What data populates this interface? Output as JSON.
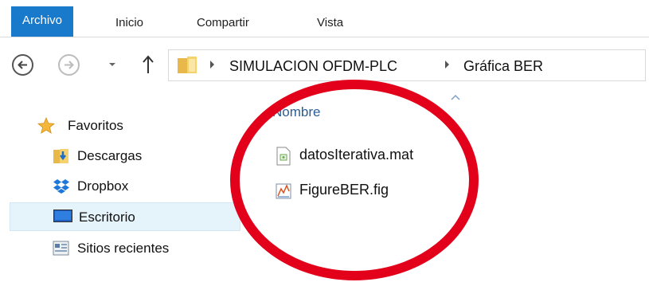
{
  "ribbon": {
    "tabs": [
      {
        "label": "Archivo",
        "active": true
      },
      {
        "label": "Inicio",
        "active": false
      },
      {
        "label": "Compartir",
        "active": false
      },
      {
        "label": "Vista",
        "active": false
      }
    ]
  },
  "nav": {
    "back_icon": "back-arrow-icon",
    "forward_icon": "forward-arrow-icon",
    "recent_icon": "chevron-down-icon",
    "up_icon": "up-arrow-icon"
  },
  "address": {
    "folder_icon": "folder-icon",
    "crumbs": [
      "SIMULACION OFDM-PLC",
      "Gráfica BER"
    ]
  },
  "sidebar": {
    "items": [
      {
        "label": "Favoritos",
        "icon": "star-icon"
      },
      {
        "label": "Descargas",
        "icon": "downloads-folder-icon"
      },
      {
        "label": "Dropbox",
        "icon": "dropbox-icon"
      },
      {
        "label": "Escritorio",
        "icon": "desktop-icon",
        "selected": true
      },
      {
        "label": "Sitios recientes",
        "icon": "recent-places-icon"
      }
    ]
  },
  "files": {
    "column_header": "Nombre",
    "items": [
      {
        "name": "datosIterativa.mat",
        "icon": "mat-file-icon"
      },
      {
        "name": "FigureBER.fig",
        "icon": "fig-file-icon"
      }
    ]
  },
  "colors": {
    "accent": "#1979ca",
    "annotation": "#e3001b",
    "header_text": "#2b5e95",
    "selection": "#e5f3fb"
  }
}
